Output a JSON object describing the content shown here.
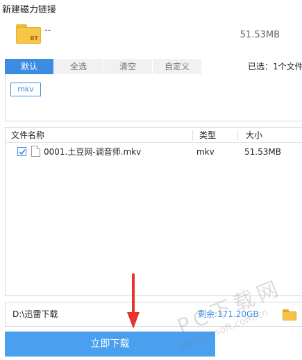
{
  "window": {
    "title": "新建磁力链接"
  },
  "task": {
    "icon_label": "BT",
    "name": "--",
    "size": "51.53MB"
  },
  "filter": {
    "tabs": [
      {
        "label": "默认",
        "active": true
      },
      {
        "label": "全选",
        "active": false
      },
      {
        "label": "清空",
        "active": false
      },
      {
        "label": "自定义",
        "active": false
      }
    ],
    "selected_count": "已选：1个文件"
  },
  "extensions": [
    "mkv"
  ],
  "file_list": {
    "columns": {
      "name": "文件名称",
      "type": "类型",
      "size": "大小"
    },
    "rows": [
      {
        "checked": true,
        "name": "0001.土豆网-调音师.mkv",
        "type": "mkv",
        "size": "51.53MB"
      }
    ]
  },
  "save_path": {
    "path": "D:\\迅雷下载",
    "free_space": "剩余:171.20GB"
  },
  "actions": {
    "download_label": "立即下载"
  },
  "watermark": {
    "text": "PC下载网",
    "url": "www.pcsoft.com.cn"
  },
  "colors": {
    "accent": "#3b8ce2",
    "button": "#4aa0ef",
    "arrow": "#e8342f"
  }
}
